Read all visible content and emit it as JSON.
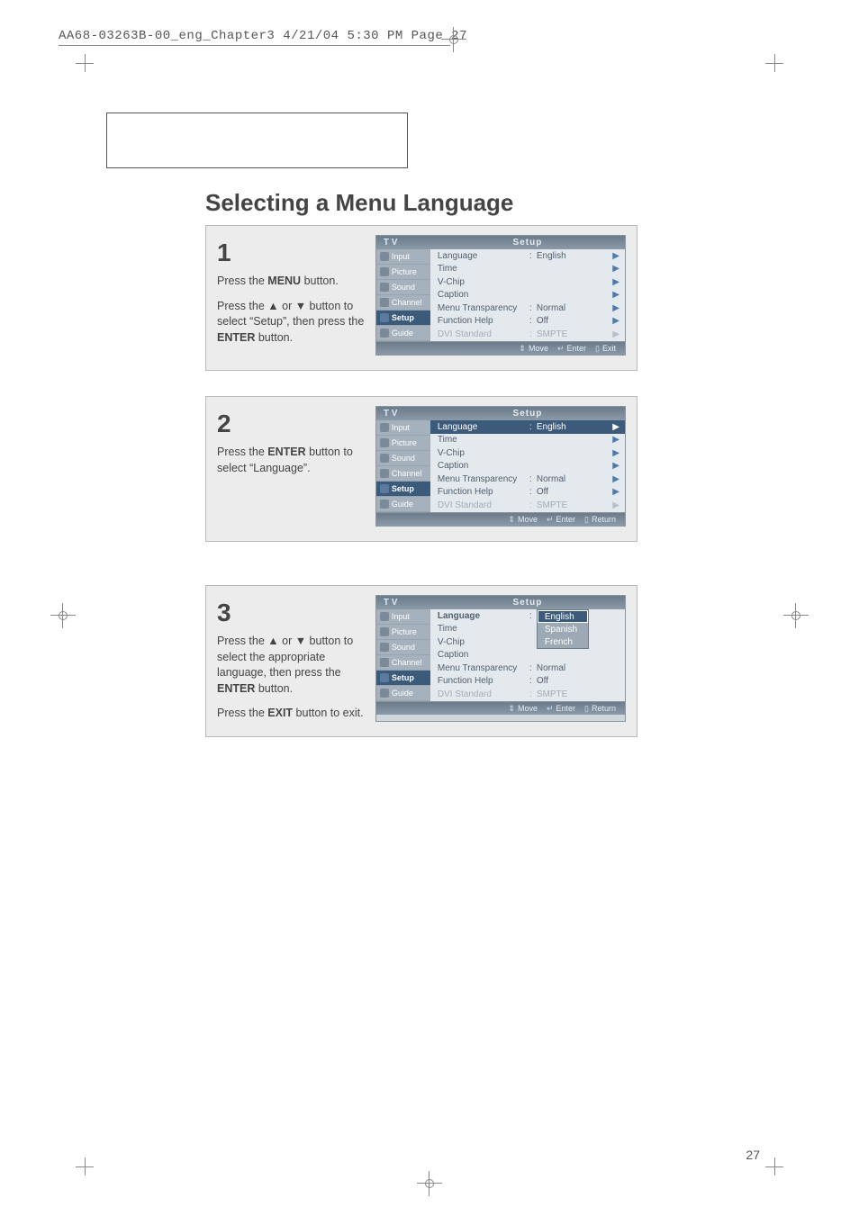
{
  "header": {
    "runner": "AA68-03263B-00_eng_Chapter3  4/21/04  5:30 PM  Page 27"
  },
  "page_title": "Selecting a Menu Language",
  "sidebar_items": [
    {
      "label": "Input"
    },
    {
      "label": "Picture"
    },
    {
      "label": "Sound"
    },
    {
      "label": "Channel"
    },
    {
      "label": "Setup"
    },
    {
      "label": "Guide"
    }
  ],
  "osd": {
    "tv_label": "T V",
    "title": "Setup",
    "rows": [
      {
        "label": "Language",
        "colon": ":",
        "val": "English"
      },
      {
        "label": "Time",
        "colon": "",
        "val": ""
      },
      {
        "label": "V-Chip",
        "colon": "",
        "val": ""
      },
      {
        "label": "Caption",
        "colon": "",
        "val": ""
      },
      {
        "label": "Menu Transparency",
        "colon": ":",
        "val": "Normal"
      },
      {
        "label": "Function Help",
        "colon": ":",
        "val": "Off"
      },
      {
        "label": "DVI Standard",
        "colon": ":",
        "val": "SMPTE"
      }
    ],
    "footer": {
      "move": "Move",
      "enter": "Enter",
      "exit": "Exit",
      "return": "Return"
    }
  },
  "step1": {
    "num": "1",
    "p1a": "Press the ",
    "p1b": "MENU",
    "p1c": " button.",
    "p2a": "Press the ▲ or ▼ button to select “Setup”, then press the ",
    "p2b": "ENTER",
    "p2c": " button."
  },
  "step2": {
    "num": "2",
    "p1a": "Press the ",
    "p1b": "ENTER",
    "p1c": " button to select “Language”."
  },
  "step3": {
    "num": "3",
    "p1a": "Press the ▲ or ▼ button to select the appropriate language, then press the ",
    "p1b": "ENTER",
    "p1c": " button.",
    "p2a": "Press the ",
    "p2b": "EXIT",
    "p2c": " button to exit.",
    "popup": [
      "English",
      "Spanish",
      "French"
    ]
  },
  "page_number": "27"
}
